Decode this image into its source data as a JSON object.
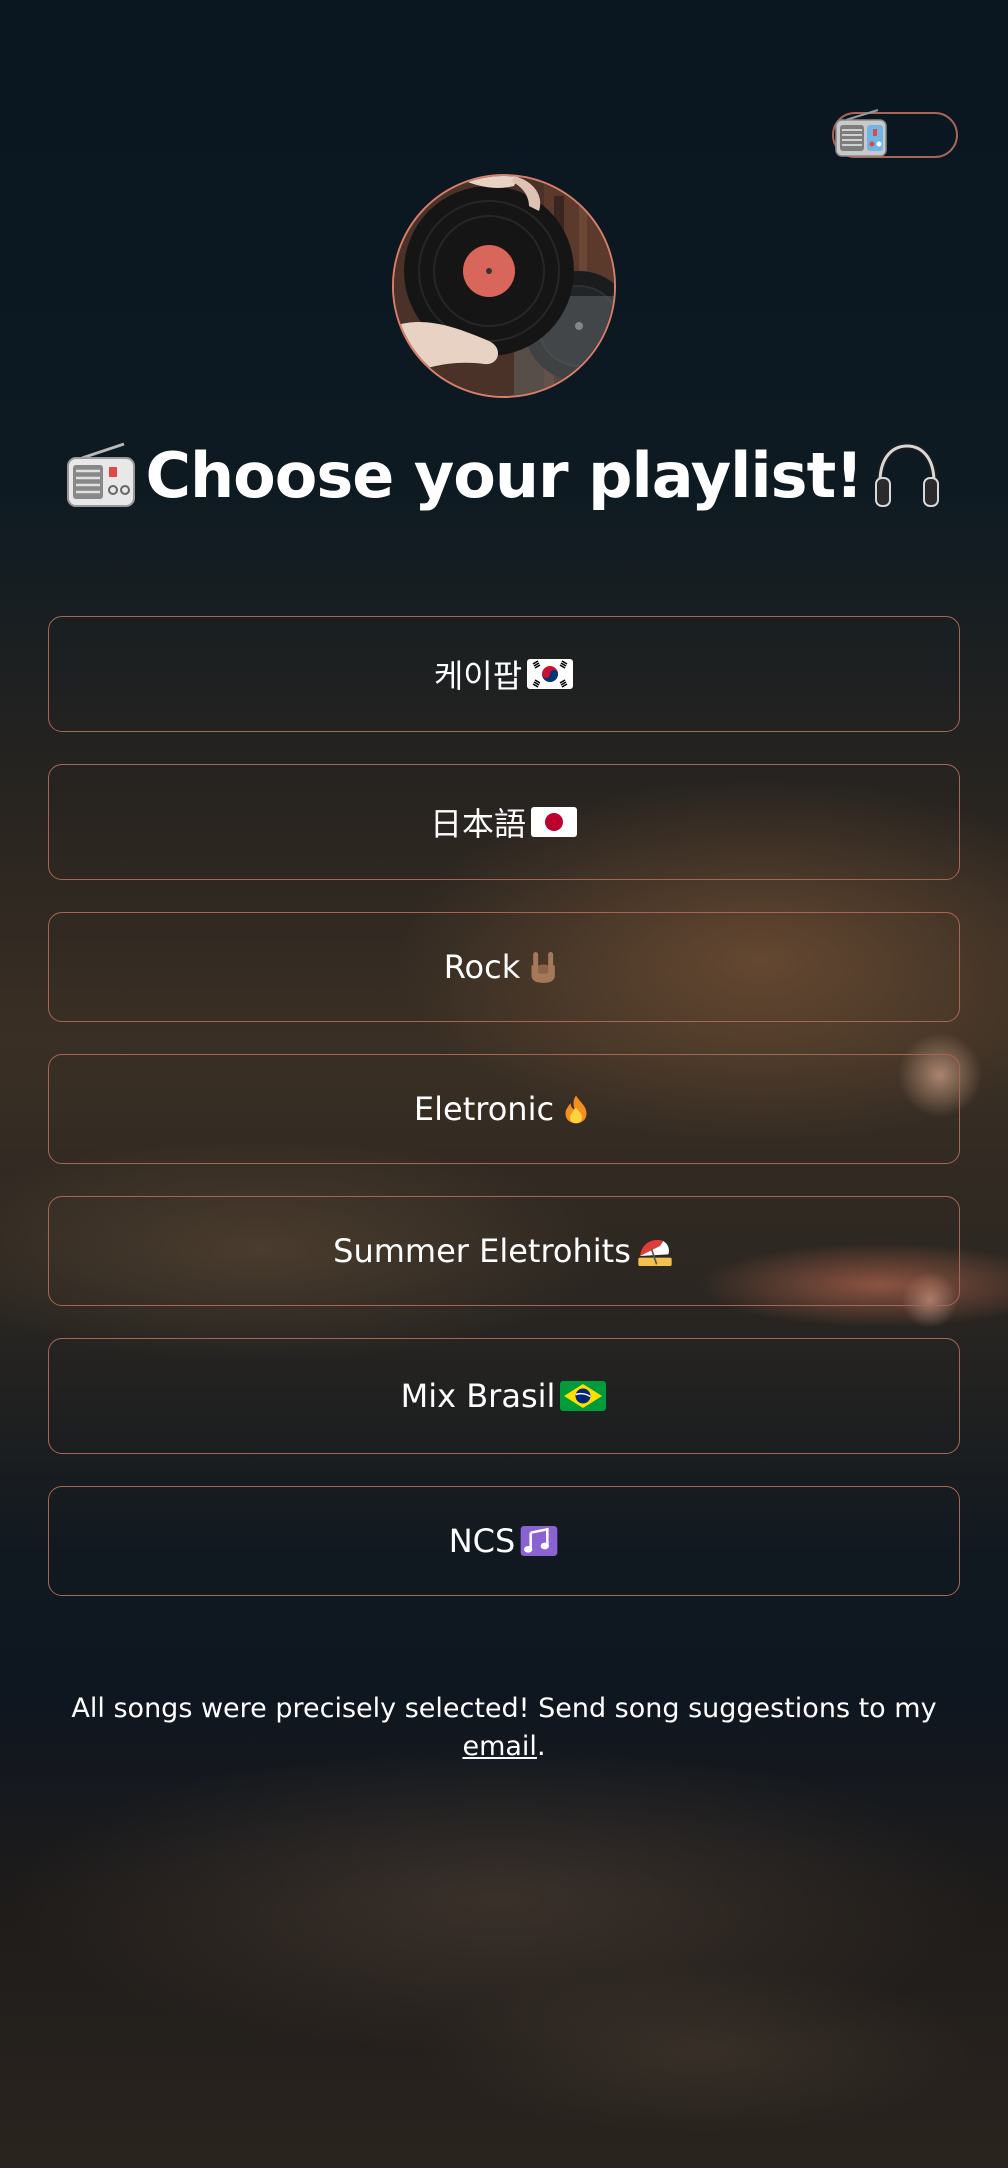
{
  "header": {
    "title": "Choose your playlist!",
    "title_left_icon": "radio-icon",
    "title_right_icon": "headphones-icon"
  },
  "theme_toggle": {
    "icon": "radio-icon",
    "border_color": "#a4665a"
  },
  "avatar": {
    "description_icon": "vinyl-record-avatar",
    "border_color": "#d87e6b"
  },
  "playlists": [
    {
      "label": "케이팝",
      "icon": "south-korea-flag-icon"
    },
    {
      "label": "日本語",
      "icon": "japan-flag-icon"
    },
    {
      "label": "Rock",
      "icon": "rock-hand-icon"
    },
    {
      "label": "Eletronic",
      "icon": "fire-icon"
    },
    {
      "label": "Summer Eletrohits",
      "icon": "beach-umbrella-icon"
    },
    {
      "label": "Mix Brasil",
      "icon": "brazil-flag-icon"
    },
    {
      "label": "NCS",
      "icon": "music-notes-icon"
    }
  ],
  "footer": {
    "text": "All songs were precisely selected! Send song suggestions to my",
    "link_text": "email",
    "end": "."
  },
  "colors": {
    "button_border": "#a76556",
    "text": "#ffffff"
  }
}
